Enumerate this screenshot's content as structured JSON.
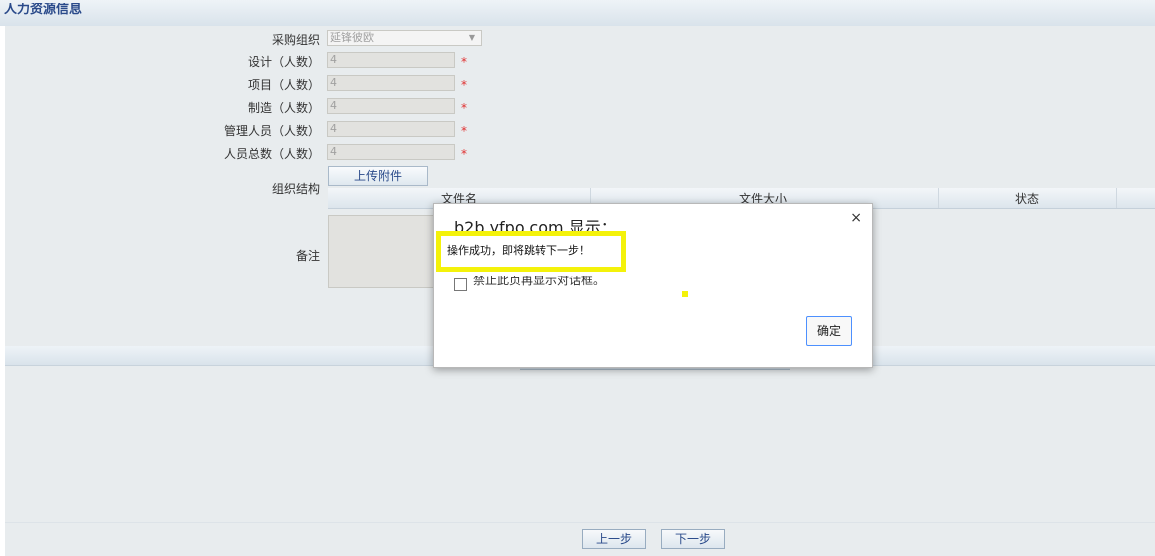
{
  "section": {
    "title": "人力资源信息"
  },
  "form": {
    "purchase_org": {
      "label": "采购组织",
      "value": "延锋彼欧"
    },
    "design": {
      "label": "设计（人数）",
      "value": "4"
    },
    "project": {
      "label": "项目（人数）",
      "value": "4"
    },
    "manufacturing": {
      "label": "制造（人数）",
      "value": "4"
    },
    "management": {
      "label": "管理人员（人数）",
      "value": "4"
    },
    "total": {
      "label": "人员总数（人数）",
      "value": "4"
    },
    "required_mark": "*",
    "org_structure": {
      "label": "组织结构",
      "upload_label": "上传附件"
    },
    "file_table": {
      "columns": [
        "文件名",
        "文件大小",
        "状态"
      ]
    },
    "remarks": {
      "label": "备注"
    }
  },
  "navigation": {
    "prev_label": "上一步",
    "next_label": "下一步"
  },
  "dialog": {
    "title": "b2b.yfpo.com 显示：",
    "message": "操作成功，即将跳转下一步！",
    "checkbox_label": "禁止此页再显示对话框。",
    "ok_label": "确定",
    "close_icon": "×"
  },
  "colors": {
    "highlight": "#f4f20a",
    "required": "#e03030",
    "link_blue": "#2a4a8a",
    "ok_border": "#4d90fe"
  }
}
